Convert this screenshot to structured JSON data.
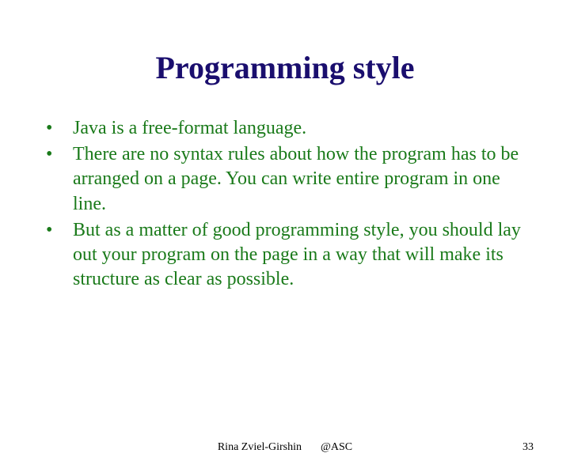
{
  "title": "Programming style",
  "bullets": [
    "Java is a free-format language.",
    "There are no syntax rules about how the program has to be arranged on a page. You can write entire program in one line.",
    "But as a matter of good programming style, you should lay out your program on the page in a way that will make its structure as clear as possible."
  ],
  "footer": {
    "author": "Rina Zviel-Girshin",
    "org": "@ASC",
    "page": "33"
  }
}
